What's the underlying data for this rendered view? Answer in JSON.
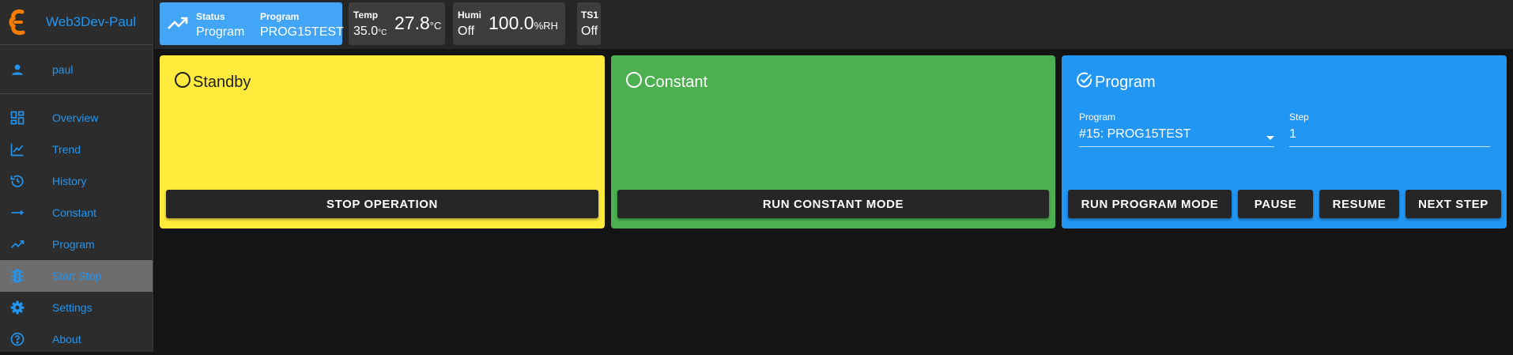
{
  "sidebar": {
    "brand": "Web3Dev-Paul",
    "user": "paul",
    "items": [
      {
        "label": "Overview",
        "icon": "dashboard-icon"
      },
      {
        "label": "Trend",
        "icon": "trend-chart-icon"
      },
      {
        "label": "History",
        "icon": "history-icon"
      },
      {
        "label": "Constant",
        "icon": "arrow-right-icon"
      },
      {
        "label": "Program",
        "icon": "trending-up-icon"
      },
      {
        "label": "Start Stop",
        "icon": "traffic-light-icon",
        "active": true
      },
      {
        "label": "Settings",
        "icon": "gear-icon"
      },
      {
        "label": "About",
        "icon": "help-circle-icon"
      }
    ]
  },
  "topbar": {
    "status": {
      "label": "Status",
      "value": "Program"
    },
    "program": {
      "label": "Program",
      "value": "PROG15TEST"
    },
    "temp": {
      "label": "Temp",
      "setpoint": "35.0",
      "setpoint_unit": "°C",
      "value": "27.8",
      "unit": "°C"
    },
    "humi": {
      "label": "Humi",
      "state": "Off",
      "value": "100.0",
      "unit": "%RH"
    },
    "ts1": {
      "label": "TS1",
      "state": "Off"
    }
  },
  "panels": {
    "standby": {
      "title": "Standby",
      "button": "STOP OPERATION",
      "selected": false
    },
    "constant": {
      "title": "Constant",
      "button": "RUN CONSTANT MODE",
      "selected": false
    },
    "program": {
      "title": "Program",
      "selected": true,
      "program_label": "Program",
      "program_value": "#15: PROG15TEST",
      "step_label": "Step",
      "step_value": "1",
      "buttons": {
        "run": "RUN PROGRAM MODE",
        "pause": "PAUSE",
        "resume": "RESUME",
        "next": "NEXT STEP"
      }
    }
  },
  "colors": {
    "accent": "#2196f3",
    "standby": "#ffeb3b",
    "constant": "#4caf50",
    "program": "#2196f3",
    "status_tile": "#42a5f5",
    "brand_logo": "#f57c00"
  }
}
